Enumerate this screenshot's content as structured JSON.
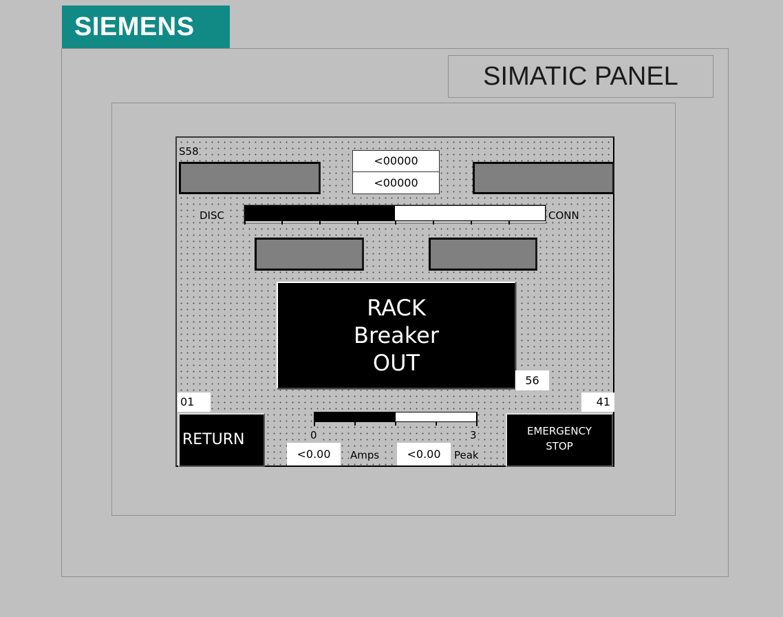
{
  "brand": {
    "logo_text": "SIEMENS",
    "color": "#118a86"
  },
  "panel": {
    "title": "SIMATIC PANEL"
  },
  "screen": {
    "station_label": "S58",
    "counters": [
      "<00000",
      "<00000"
    ],
    "position": {
      "left_label": "DISC",
      "right_label": "CONN",
      "fill_fraction": 0.5
    },
    "status": {
      "lines": [
        "RACK",
        "Breaker",
        "OUT"
      ]
    },
    "numbers": {
      "screen_no": "56",
      "prev_screen": "01",
      "next_screen": "41"
    },
    "buttons": {
      "return_label": "RETURN",
      "estop_line1": "EMERGENCY",
      "estop_line2": "STOP"
    },
    "amps_meter": {
      "min_label": "0",
      "max_label": "3",
      "fill_fraction": 0.5,
      "amps_value": "<0.00",
      "amps_unit": "Amps",
      "peak_value": "<0.00",
      "peak_unit": "Peak"
    },
    "indicator_color": "#808080"
  }
}
